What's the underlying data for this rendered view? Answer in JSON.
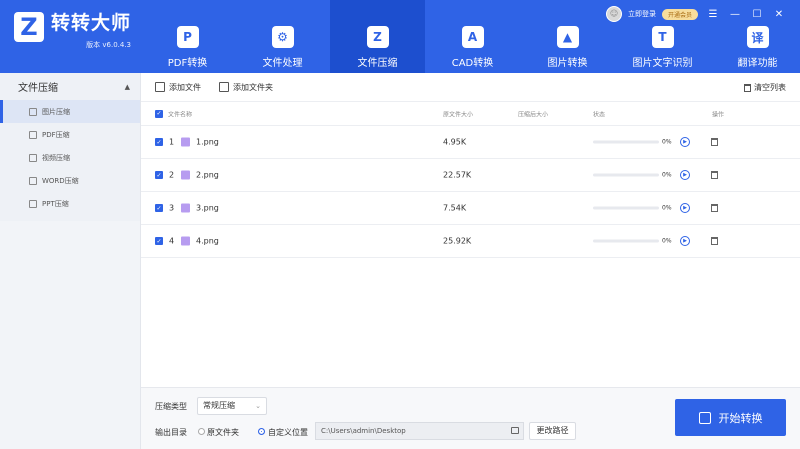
{
  "app": {
    "logo_mark": "Z",
    "name": "转转大师",
    "version": "版本 v6.0.4.3"
  },
  "header": {
    "login_label": "立即登录",
    "vip_label": "开通会员",
    "avatar_glyph": "☺",
    "window_controls": [
      "☰",
      "—",
      "☐",
      "✕"
    ]
  },
  "nav": [
    {
      "label": "PDF转换",
      "icon": "pdf-convert-icon",
      "glyph": "P"
    },
    {
      "label": "文件处理",
      "icon": "file-process-icon",
      "glyph": "⚙"
    },
    {
      "label": "文件压缩",
      "icon": "file-compress-icon",
      "glyph": "Z",
      "active": true
    },
    {
      "label": "CAD转换",
      "icon": "cad-icon",
      "glyph": "A"
    },
    {
      "label": "图片转换",
      "icon": "image-convert-icon",
      "glyph": "▲"
    },
    {
      "label": "图片文字识别",
      "icon": "ocr-icon",
      "glyph": "T"
    },
    {
      "label": "翻译功能",
      "icon": "translate-icon",
      "glyph": "译"
    }
  ],
  "sidebar": {
    "title": "文件压缩",
    "collapse_glyph": "▲",
    "items": [
      {
        "label": "图片压缩",
        "active": true
      },
      {
        "label": "PDF压缩"
      },
      {
        "label": "视频压缩"
      },
      {
        "label": "WORD压缩"
      },
      {
        "label": "PPT压缩"
      }
    ]
  },
  "toolbar": {
    "add_file": "添加文件",
    "add_folder": "添加文件夹",
    "clear_list": "清空列表"
  },
  "table": {
    "columns": {
      "name": "文件名称",
      "orig_size": "原文件大小",
      "comp_size": "压缩后大小",
      "status": "状态",
      "action": "操作"
    },
    "rows": [
      {
        "index": "1",
        "name": "1.png",
        "size": "4.95K",
        "progress": "0%"
      },
      {
        "index": "2",
        "name": "2.png",
        "size": "22.57K",
        "progress": "0%"
      },
      {
        "index": "3",
        "name": "3.png",
        "size": "7.54K",
        "progress": "0%"
      },
      {
        "index": "4",
        "name": "4.png",
        "size": "25.92K",
        "progress": "0%"
      }
    ]
  },
  "footer": {
    "compress_type_label": "压缩类型",
    "compress_type_value": "常规压缩",
    "output_label": "输出目录",
    "option_original": "原文件夹",
    "option_custom": "自定义位置",
    "path": "C:\\Users\\admin\\Desktop",
    "change_path": "更改路径",
    "start": "开始转换"
  },
  "colors": {
    "brand": "#2f63e6",
    "nav_active": "#1d4fcf"
  }
}
